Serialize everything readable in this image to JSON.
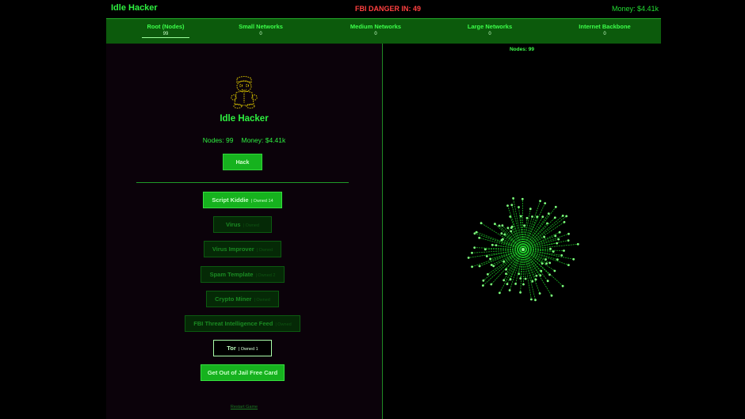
{
  "header": {
    "title": "Idle Hacker",
    "danger": "FBI DANGER IN: 49",
    "money": "Money: $4.41k"
  },
  "tabs": [
    {
      "name": "Root (Nodes)",
      "value": "99",
      "active": true
    },
    {
      "name": "Small Networks",
      "value": "0"
    },
    {
      "name": "Medium Networks",
      "value": "0"
    },
    {
      "name": "Large Networks",
      "value": "0"
    },
    {
      "name": "Internet Backbone",
      "value": "0"
    }
  ],
  "player": {
    "name": "Idle Hacker",
    "nodes": "Nodes: 99",
    "money": "Money: $4.41k"
  },
  "hack_button": "Hack",
  "upgrades": [
    {
      "label": "Script Kiddie",
      "owned": "| Owned 14",
      "state": "bright"
    },
    {
      "label": "Virus",
      "owned": "| Owned",
      "state": "dim"
    },
    {
      "label": "Virus Improver",
      "owned": "| Owned",
      "state": "dim"
    },
    {
      "label": "Spam Template",
      "owned": "| Owned 2",
      "state": "dim"
    },
    {
      "label": "Crypto Miner",
      "owned": "| Owned",
      "state": "dim"
    },
    {
      "label": "FBI Threat Intelligence Feed",
      "owned": "| Owned",
      "state": "dim"
    },
    {
      "label": "Tor",
      "owned": "| Owned 1",
      "state": "tor"
    },
    {
      "label": "Get Out of Jail Free Card",
      "owned": "",
      "state": "bright"
    }
  ],
  "restart": "Restart Game",
  "graph": {
    "label": "Nodes: 99",
    "node_count": 99,
    "line_color": "#1fd02a",
    "node_color": "#7dff7d"
  },
  "colors": {
    "accent": "#22dd33",
    "danger": "#ff4040",
    "tab_bg": "#0c5a0c",
    "panel_bg": "#0b020a"
  }
}
